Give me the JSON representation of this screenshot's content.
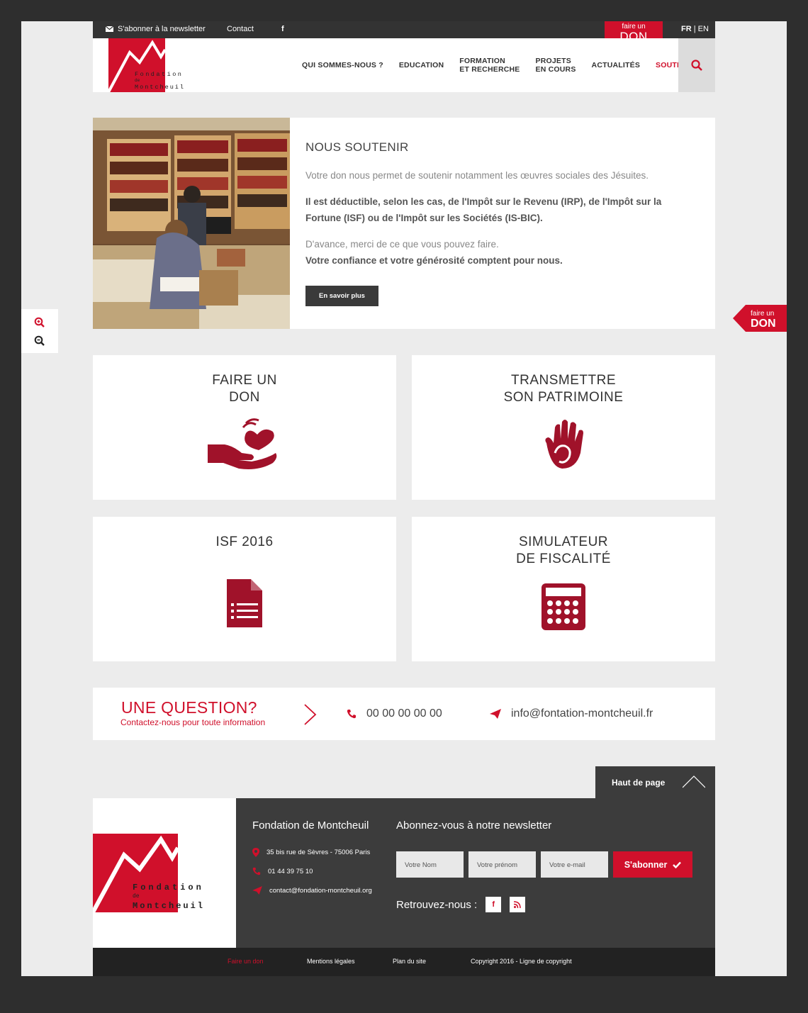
{
  "topbar": {
    "newsletter": "S'abonner à la newsletter",
    "contact": "Contact",
    "facebook": "f",
    "don_small": "faire un",
    "don_big": "DON",
    "lang_fr": "FR",
    "lang_sep": " | ",
    "lang_en": "EN"
  },
  "logo": {
    "line1": "Fondation",
    "line2": "de",
    "line3": "Montcheuil"
  },
  "nav": [
    {
      "label": "QUI SOMMES-NOUS ?",
      "label2": ""
    },
    {
      "label": "EDUCATION",
      "label2": ""
    },
    {
      "label": "FORMATION",
      "label2": "ET RECHERCHE"
    },
    {
      "label": "PROJETS",
      "label2": "EN COURS"
    },
    {
      "label": "ACTUALITÉS",
      "label2": ""
    },
    {
      "label": "SOUTENIR",
      "label2": ""
    }
  ],
  "intro": {
    "title": "NOUS SOUTENIR",
    "p1": "Votre don nous permet de soutenir notamment les œuvres sociales des Jésuites.",
    "p2": "Il est déductible, selon les cas, de l'Impôt sur le Revenu (IRP), de l'Impôt sur la Fortune (ISF) ou de l'Impôt sur les Sociétés (IS-BIC).",
    "p3": "D'avance, merci de ce que vous pouvez faire.",
    "p4": "Votre confiance et votre générosité comptent pour nous.",
    "button": "En savoir plus"
  },
  "side_don": {
    "small": "faire un",
    "big": "DON"
  },
  "cards": [
    {
      "line1": "FAIRE UN",
      "line2": "DON",
      "icon": "heart-hand-icon"
    },
    {
      "line1": "TRANSMETTRE",
      "line2": "SON PATRIMOINE",
      "icon": "hands-icon"
    },
    {
      "line1": "ISF 2016",
      "line2": "",
      "icon": "document-icon"
    },
    {
      "line1": "SIMULATEUR",
      "line2": "DE FISCALITÉ",
      "icon": "calculator-icon"
    }
  ],
  "question": {
    "title": "UNE QUESTION?",
    "subtitle": "Contactez-nous pour toute information",
    "phone": "00 00 00 00 00",
    "email": "info@fontation-montcheuil.fr"
  },
  "back_to_top": "Haut de page",
  "footer": {
    "org_title": "Fondation de Montcheuil",
    "address": "35 bis rue de Sèvres - 75006 Paris",
    "phone": "01 44 39 75 10",
    "email": "contact@fondation-montcheuil.org",
    "newsletter_title": "Abonnez-vous à notre newsletter",
    "name_placeholder": "Votre Nom",
    "firstname_placeholder": "Votre prénom",
    "email_placeholder": "Votre e-mail",
    "subscribe": "S'abonner",
    "follow": "Retrouvez-nous :"
  },
  "bottom": {
    "link1": "Faire un don",
    "link2": "Mentions légales",
    "link3": "Plan du site",
    "copyright": "Copyright 2016 - Ligne de copyright"
  },
  "colors": {
    "brand_red": "#d0102b",
    "dark": "#3c3c3c",
    "background": "#ececec"
  }
}
